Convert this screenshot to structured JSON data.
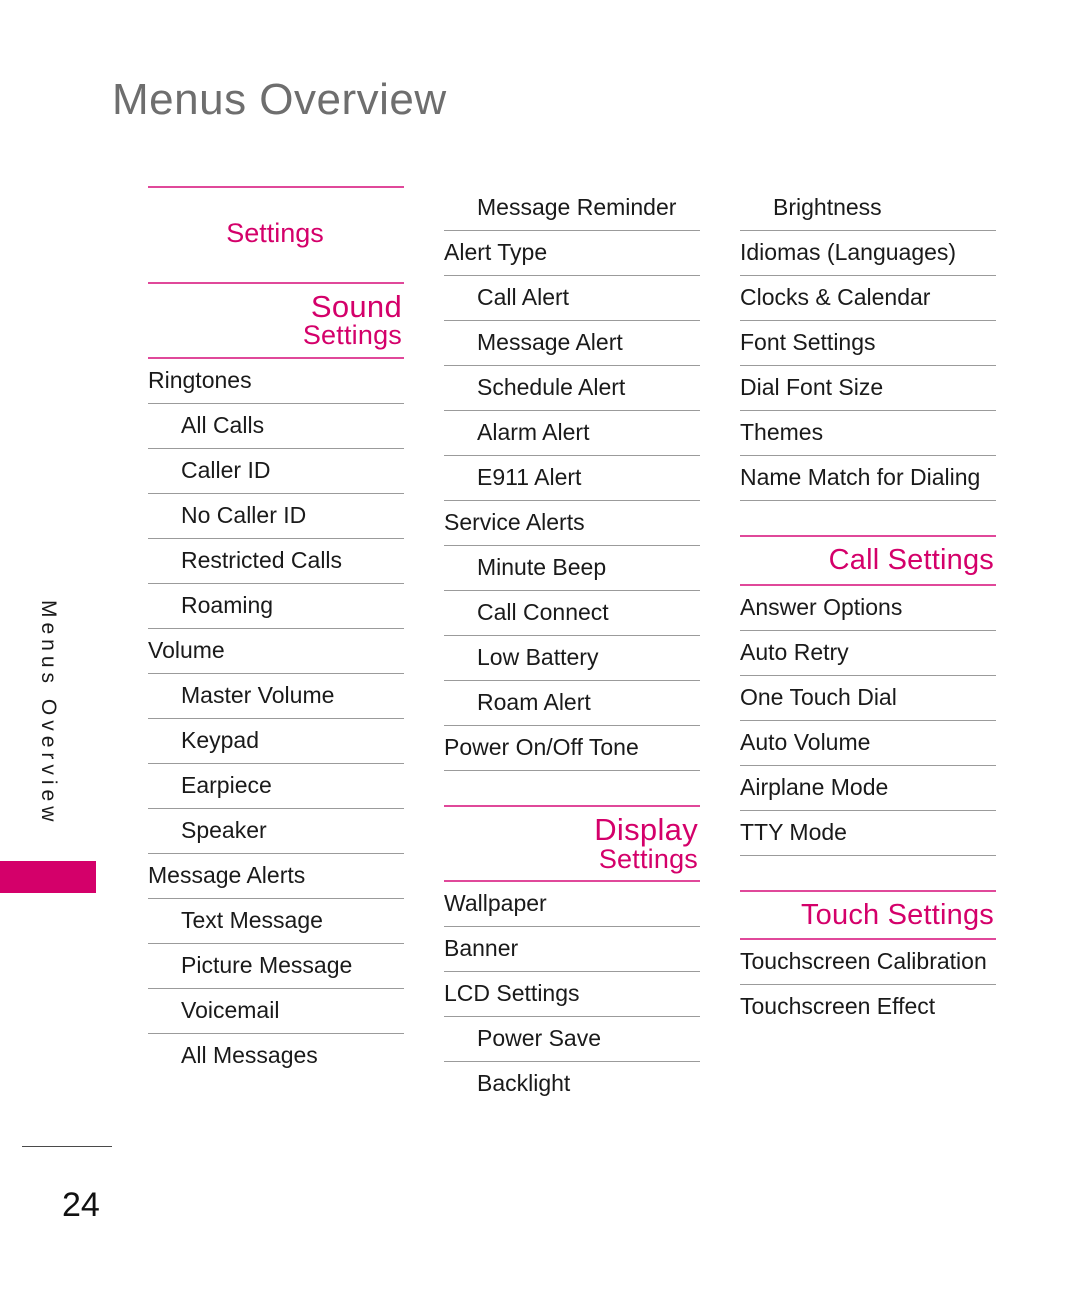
{
  "page": {
    "title": "Menus Overview",
    "number": "24",
    "side_tab_label": "Menus Overview",
    "accent_pink": "#d4006a",
    "rule_pink": "#e0489a",
    "rule_gray": "#9b9b9b",
    "title_color": "#6e6e6e"
  },
  "columns": [
    {
      "name": "column-1",
      "blocks": [
        {
          "type": "rule",
          "style": "pink"
        },
        {
          "type": "heading",
          "variant": "plain",
          "line1": "Settings"
        },
        {
          "type": "rule",
          "style": "pink"
        },
        {
          "type": "heading",
          "variant": "stacked",
          "line1": "Sound",
          "line2": "Settings"
        },
        {
          "type": "rule",
          "style": "pink"
        },
        {
          "type": "item",
          "level": 1,
          "label": "Ringtones"
        },
        {
          "type": "rule",
          "style": "gray"
        },
        {
          "type": "item",
          "level": 2,
          "label": "All Calls"
        },
        {
          "type": "rule",
          "style": "gray"
        },
        {
          "type": "item",
          "level": 2,
          "label": "Caller ID"
        },
        {
          "type": "rule",
          "style": "gray"
        },
        {
          "type": "item",
          "level": 2,
          "label": "No Caller ID"
        },
        {
          "type": "rule",
          "style": "gray"
        },
        {
          "type": "item",
          "level": 2,
          "label": "Restricted Calls"
        },
        {
          "type": "rule",
          "style": "gray"
        },
        {
          "type": "item",
          "level": 2,
          "label": "Roaming"
        },
        {
          "type": "rule",
          "style": "gray"
        },
        {
          "type": "item",
          "level": 1,
          "label": "Volume"
        },
        {
          "type": "rule",
          "style": "gray"
        },
        {
          "type": "item",
          "level": 2,
          "label": "Master Volume"
        },
        {
          "type": "rule",
          "style": "gray"
        },
        {
          "type": "item",
          "level": 2,
          "label": "Keypad"
        },
        {
          "type": "rule",
          "style": "gray"
        },
        {
          "type": "item",
          "level": 2,
          "label": "Earpiece"
        },
        {
          "type": "rule",
          "style": "gray"
        },
        {
          "type": "item",
          "level": 2,
          "label": "Speaker"
        },
        {
          "type": "rule",
          "style": "gray"
        },
        {
          "type": "item",
          "level": 1,
          "label": "Message Alerts"
        },
        {
          "type": "rule",
          "style": "gray"
        },
        {
          "type": "item",
          "level": 2,
          "label": "Text Message"
        },
        {
          "type": "rule",
          "style": "gray"
        },
        {
          "type": "item",
          "level": 2,
          "label": "Picture Message"
        },
        {
          "type": "rule",
          "style": "gray"
        },
        {
          "type": "item",
          "level": 2,
          "label": "Voicemail"
        },
        {
          "type": "rule",
          "style": "gray"
        },
        {
          "type": "item",
          "level": 2,
          "label": "All Messages"
        }
      ]
    },
    {
      "name": "column-2",
      "blocks": [
        {
          "type": "item",
          "level": 2,
          "label": "Message Reminder"
        },
        {
          "type": "rule",
          "style": "gray"
        },
        {
          "type": "item",
          "level": 1,
          "label": "Alert Type"
        },
        {
          "type": "rule",
          "style": "gray"
        },
        {
          "type": "item",
          "level": 2,
          "label": "Call Alert"
        },
        {
          "type": "rule",
          "style": "gray"
        },
        {
          "type": "item",
          "level": 2,
          "label": "Message Alert"
        },
        {
          "type": "rule",
          "style": "gray"
        },
        {
          "type": "item",
          "level": 2,
          "label": "Schedule Alert"
        },
        {
          "type": "rule",
          "style": "gray"
        },
        {
          "type": "item",
          "level": 2,
          "label": "Alarm Alert"
        },
        {
          "type": "rule",
          "style": "gray"
        },
        {
          "type": "item",
          "level": 2,
          "label": "E911  Alert"
        },
        {
          "type": "rule",
          "style": "gray"
        },
        {
          "type": "item",
          "level": 1,
          "label": "Service Alerts"
        },
        {
          "type": "rule",
          "style": "gray"
        },
        {
          "type": "item",
          "level": 2,
          "label": "Minute Beep"
        },
        {
          "type": "rule",
          "style": "gray"
        },
        {
          "type": "item",
          "level": 2,
          "label": "Call Connect"
        },
        {
          "type": "rule",
          "style": "gray"
        },
        {
          "type": "item",
          "level": 2,
          "label": "Low Battery"
        },
        {
          "type": "rule",
          "style": "gray"
        },
        {
          "type": "item",
          "level": 2,
          "label": "Roam Alert"
        },
        {
          "type": "rule",
          "style": "gray"
        },
        {
          "type": "item",
          "level": 1,
          "label": "Power On/Off Tone"
        },
        {
          "type": "rule",
          "style": "gray"
        },
        {
          "type": "gap"
        },
        {
          "type": "rule",
          "style": "pink"
        },
        {
          "type": "heading",
          "variant": "stacked",
          "line1": "Display",
          "line2": "Settings"
        },
        {
          "type": "rule",
          "style": "pink"
        },
        {
          "type": "item",
          "level": 1,
          "label": "Wallpaper"
        },
        {
          "type": "rule",
          "style": "gray"
        },
        {
          "type": "item",
          "level": 1,
          "label": "Banner"
        },
        {
          "type": "rule",
          "style": "gray"
        },
        {
          "type": "item",
          "level": 1,
          "label": "LCD Settings"
        },
        {
          "type": "rule",
          "style": "gray"
        },
        {
          "type": "item",
          "level": 2,
          "label": "Power Save"
        },
        {
          "type": "rule",
          "style": "gray"
        },
        {
          "type": "item",
          "level": 2,
          "label": "Backlight"
        }
      ]
    },
    {
      "name": "column-3",
      "blocks": [
        {
          "type": "item",
          "level": 2,
          "label": "Brightness"
        },
        {
          "type": "rule",
          "style": "gray"
        },
        {
          "type": "item",
          "level": 1,
          "label": "Idiomas (Languages)"
        },
        {
          "type": "rule",
          "style": "gray"
        },
        {
          "type": "item",
          "level": 1,
          "label": "Clocks & Calendar"
        },
        {
          "type": "rule",
          "style": "gray"
        },
        {
          "type": "item",
          "level": 1,
          "label": "Font Settings"
        },
        {
          "type": "rule",
          "style": "gray"
        },
        {
          "type": "item",
          "level": 1,
          "label": "Dial Font Size"
        },
        {
          "type": "rule",
          "style": "gray"
        },
        {
          "type": "item",
          "level": 1,
          "label": "Themes"
        },
        {
          "type": "rule",
          "style": "gray"
        },
        {
          "type": "item",
          "level": 1,
          "label": "Name Match for Dialing"
        },
        {
          "type": "rule",
          "style": "gray"
        },
        {
          "type": "gap"
        },
        {
          "type": "rule",
          "style": "pink"
        },
        {
          "type": "heading",
          "variant": "single",
          "line1": "Call Settings"
        },
        {
          "type": "rule",
          "style": "pink"
        },
        {
          "type": "item",
          "level": 1,
          "label": "Answer Options"
        },
        {
          "type": "rule",
          "style": "gray"
        },
        {
          "type": "item",
          "level": 1,
          "label": "Auto Retry"
        },
        {
          "type": "rule",
          "style": "gray"
        },
        {
          "type": "item",
          "level": 1,
          "label": "One Touch Dial"
        },
        {
          "type": "rule",
          "style": "gray"
        },
        {
          "type": "item",
          "level": 1,
          "label": "Auto Volume"
        },
        {
          "type": "rule",
          "style": "gray"
        },
        {
          "type": "item",
          "level": 1,
          "label": "Airplane Mode"
        },
        {
          "type": "rule",
          "style": "gray"
        },
        {
          "type": "item",
          "level": 1,
          "label": "TTY Mode"
        },
        {
          "type": "rule",
          "style": "gray"
        },
        {
          "type": "gap"
        },
        {
          "type": "rule",
          "style": "pink"
        },
        {
          "type": "heading",
          "variant": "single",
          "line1": "Touch Settings"
        },
        {
          "type": "rule",
          "style": "pink"
        },
        {
          "type": "item",
          "level": 1,
          "label": "Touchscreen Calibration"
        },
        {
          "type": "rule",
          "style": "gray"
        },
        {
          "type": "item",
          "level": 1,
          "label": "Touchscreen Effect"
        }
      ]
    }
  ],
  "footer": {
    "page_number": "24"
  }
}
